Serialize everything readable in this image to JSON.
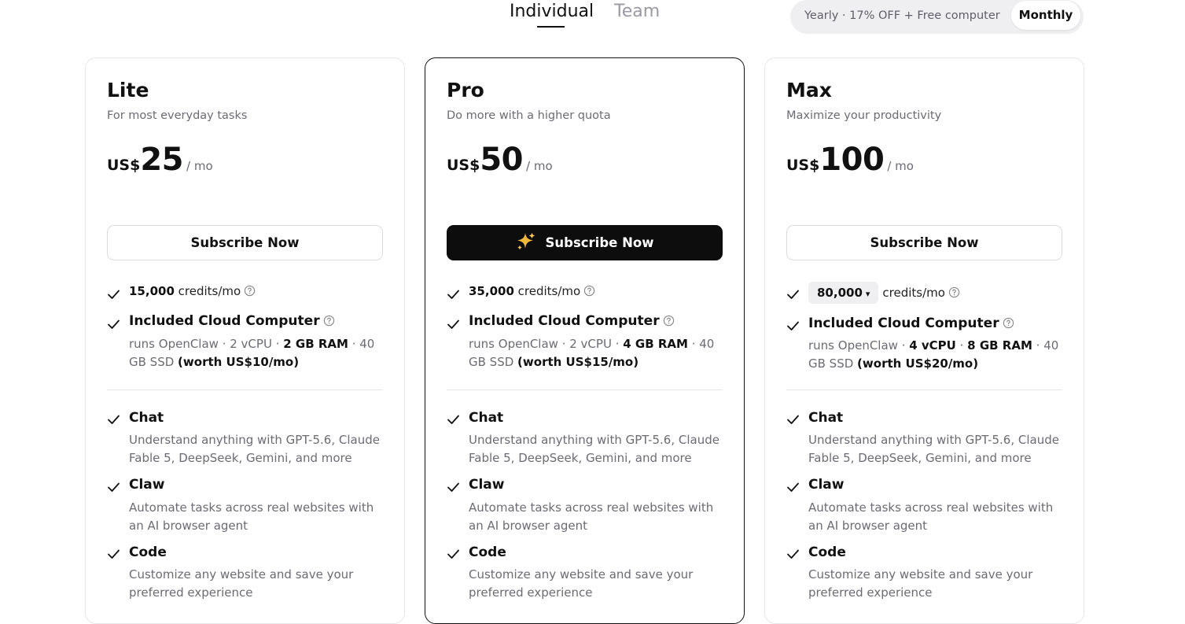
{
  "tabs": {
    "individual": "Individual",
    "team": "Team"
  },
  "billing": {
    "yearly": "Yearly · 17% OFF + Free computer",
    "monthly": "Monthly"
  },
  "plans": [
    {
      "name": "Lite",
      "desc": "For most everyday tasks",
      "currency": "US$",
      "price": "25",
      "period": "/ mo",
      "button": "Subscribe Now",
      "credits_value": "15,000",
      "credits_unit": "credits/mo",
      "computer_title": "Included Cloud Computer",
      "spec_a": "runs OpenClaw · 2 vCPU · ",
      "spec_b": "2 GB RAM",
      "spec_c": " · 40 GB SSD ",
      "spec_worth": "(worth US$10/mo)",
      "chat_title": "Chat",
      "chat_desc": "Understand anything with GPT-5.6, Claude Fable 5, DeepSeek, Gemini, and more",
      "claw_title": "Claw",
      "claw_desc": "Automate tasks across real websites with an AI browser agent",
      "code_title": "Code",
      "code_desc": "Customize any website and save your preferred experience"
    },
    {
      "name": "Pro",
      "desc": "Do more with a higher quota",
      "currency": "US$",
      "price": "50",
      "period": "/ mo",
      "button": "Subscribe Now",
      "credits_value": "35,000",
      "credits_unit": "credits/mo",
      "computer_title": "Included Cloud Computer",
      "spec_a": "runs OpenClaw · 2 vCPU · ",
      "spec_b": "4 GB RAM",
      "spec_c": " · 40 GB SSD ",
      "spec_worth": "(worth US$15/mo)",
      "chat_title": "Chat",
      "chat_desc": "Understand anything with GPT-5.6, Claude Fable 5, DeepSeek, Gemini, and more",
      "claw_title": "Claw",
      "claw_desc": "Automate tasks across real websites with an AI browser agent",
      "code_title": "Code",
      "code_desc": "Customize any website and save your preferred experience"
    },
    {
      "name": "Max",
      "desc": "Maximize your productivity",
      "currency": "US$",
      "price": "100",
      "period": "/ mo",
      "button": "Subscribe Now",
      "credits_value": "80,000",
      "credits_unit": "credits/mo",
      "computer_title": "Included Cloud Computer",
      "spec_a": "runs OpenClaw · ",
      "spec_b1": "4 vCPU",
      "spec_mid": " · ",
      "spec_b": "8 GB RAM",
      "spec_c": " · 40 GB SSD ",
      "spec_worth": "(worth US$20/mo)",
      "chat_title": "Chat",
      "chat_desc": "Understand anything with GPT-5.6, Claude Fable 5, DeepSeek, Gemini, and more",
      "claw_title": "Claw",
      "claw_desc": "Automate tasks across real websites with an AI browser agent",
      "code_title": "Code",
      "code_desc": "Customize any website and save your preferred experience"
    }
  ],
  "icons": {
    "check": "check-icon",
    "help": "help-circle-icon",
    "sparkle": "sparkles-icon",
    "caret": "▾"
  },
  "colors": {
    "accent_dark": "#0d0d0d",
    "muted_text": "#6b6b75",
    "sparkle": "#f5b73b"
  }
}
